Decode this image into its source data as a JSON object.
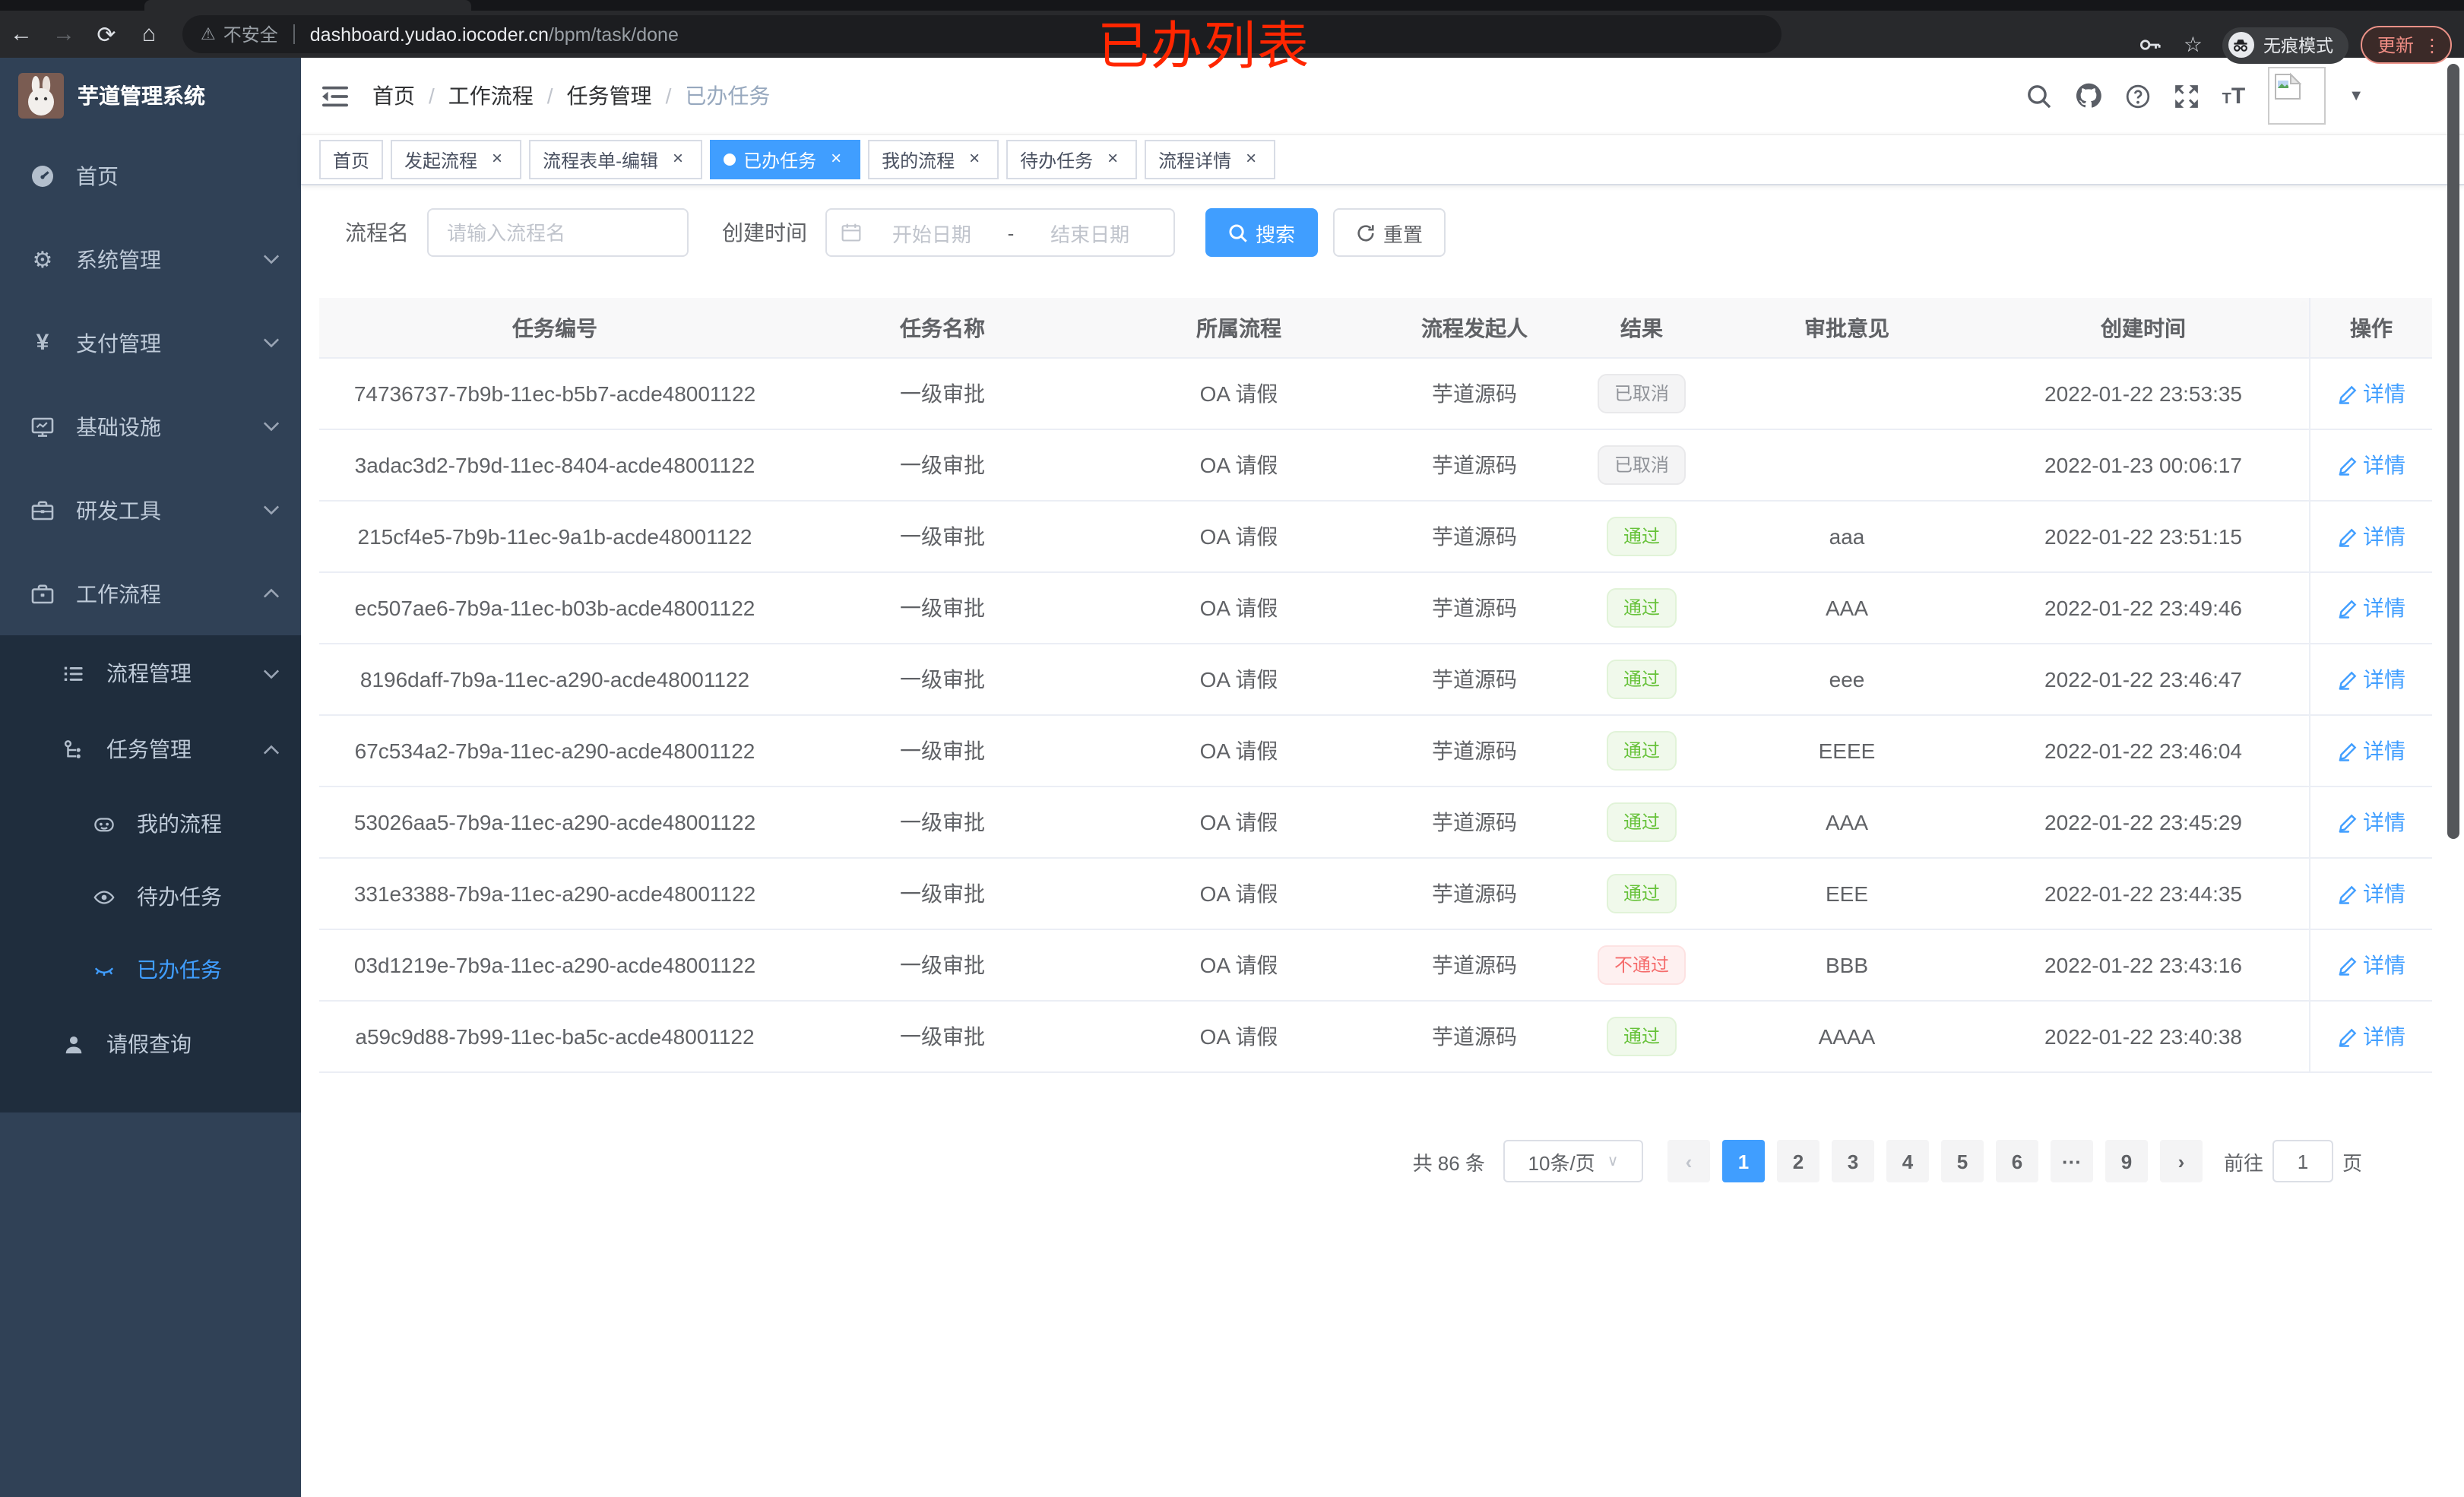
{
  "colors": {
    "accent": "#409eff",
    "success": "#67c23a",
    "danger": "#f56c6c",
    "info": "#909399",
    "sidebar_bg": "#304156",
    "submenu_bg": "#1f2d3d",
    "annotation_red": "#ff2600"
  },
  "browser": {
    "back_icon": "←",
    "forward_icon": "→",
    "reload_icon": "⟳",
    "home_icon": "⌂",
    "warning_icon": "⚠",
    "security_label": "不安全",
    "url_host": "dashboard.yudao.iocoder.cn",
    "url_path": "/bpm/task/done",
    "star_icon": "☆",
    "incognito_label": "无痕模式",
    "update_label": "更新",
    "menu_icon": "⋮"
  },
  "annotation": {
    "text": "已办列表"
  },
  "sidebar": {
    "title": "芋道管理系统",
    "items": [
      {
        "label": "首页",
        "icon": "dashboard-icon"
      },
      {
        "label": "系统管理",
        "icon": "gear-icon"
      },
      {
        "label": "支付管理",
        "icon": "yen-icon",
        "yen": "¥"
      },
      {
        "label": "基础设施",
        "icon": "monitor-icon"
      },
      {
        "label": "研发工具",
        "icon": "toolbox-icon"
      },
      {
        "label": "工作流程",
        "icon": "briefcase-icon"
      },
      {
        "label": "流程管理",
        "icon": "list-icon"
      },
      {
        "label": "任务管理",
        "icon": "flow-icon"
      },
      {
        "label": "我的流程",
        "icon": "robot-icon"
      },
      {
        "label": "待办任务",
        "icon": "eye-open-icon"
      },
      {
        "label": "已办任务",
        "icon": "eye-closed-icon"
      },
      {
        "label": "请假查询",
        "icon": "user-icon"
      }
    ]
  },
  "navbar": {
    "breadcrumb": [
      "首页",
      "工作流程",
      "任务管理",
      "已办任务"
    ],
    "separator": "/",
    "font_size_small": "T",
    "font_size_large": "T",
    "caret_icon": "▼"
  },
  "tags": {
    "close_icon": "×",
    "items": [
      {
        "label": "首页"
      },
      {
        "label": "发起流程"
      },
      {
        "label": "流程表单-编辑"
      },
      {
        "label": "已办任务"
      },
      {
        "label": "我的流程"
      },
      {
        "label": "待办任务"
      },
      {
        "label": "流程详情"
      }
    ]
  },
  "filters": {
    "name_label": "流程名",
    "name_placeholder": "请输入流程名",
    "time_label": "创建时间",
    "start_placeholder": "开始日期",
    "range_separator": "-",
    "end_placeholder": "结束日期",
    "search_label": "搜索",
    "reset_label": "重置"
  },
  "table": {
    "columns": [
      "任务编号",
      "任务名称",
      "所属流程",
      "流程发起人",
      "结果",
      "审批意见",
      "创建时间",
      "操作"
    ],
    "action_label": "详情",
    "rows": [
      {
        "id": "74736737-7b9b-11ec-b5b7-acde48001122",
        "name": "一级审批",
        "process": "OA 请假",
        "starter": "芋道源码",
        "result": "已取消",
        "comment": "",
        "time": "2022-01-22 23:53:35"
      },
      {
        "id": "3adac3d2-7b9d-11ec-8404-acde48001122",
        "name": "一级审批",
        "process": "OA 请假",
        "starter": "芋道源码",
        "result": "已取消",
        "comment": "",
        "time": "2022-01-23 00:06:17"
      },
      {
        "id": "215cf4e5-7b9b-11ec-9a1b-acde48001122",
        "name": "一级审批",
        "process": "OA 请假",
        "starter": "芋道源码",
        "result": "通过",
        "comment": "aaa",
        "time": "2022-01-22 23:51:15"
      },
      {
        "id": "ec507ae6-7b9a-11ec-b03b-acde48001122",
        "name": "一级审批",
        "process": "OA 请假",
        "starter": "芋道源码",
        "result": "通过",
        "comment": "AAA",
        "time": "2022-01-22 23:49:46"
      },
      {
        "id": "8196daff-7b9a-11ec-a290-acde48001122",
        "name": "一级审批",
        "process": "OA 请假",
        "starter": "芋道源码",
        "result": "通过",
        "comment": "eee",
        "time": "2022-01-22 23:46:47"
      },
      {
        "id": "67c534a2-7b9a-11ec-a290-acde48001122",
        "name": "一级审批",
        "process": "OA 请假",
        "starter": "芋道源码",
        "result": "通过",
        "comment": "EEEE",
        "time": "2022-01-22 23:46:04"
      },
      {
        "id": "53026aa5-7b9a-11ec-a290-acde48001122",
        "name": "一级审批",
        "process": "OA 请假",
        "starter": "芋道源码",
        "result": "通过",
        "comment": "AAA",
        "time": "2022-01-22 23:45:29"
      },
      {
        "id": "331e3388-7b9a-11ec-a290-acde48001122",
        "name": "一级审批",
        "process": "OA 请假",
        "starter": "芋道源码",
        "result": "通过",
        "comment": "EEE",
        "time": "2022-01-22 23:44:35"
      },
      {
        "id": "03d1219e-7b9a-11ec-a290-acde48001122",
        "name": "一级审批",
        "process": "OA 请假",
        "starter": "芋道源码",
        "result": "不通过",
        "comment": "BBB",
        "time": "2022-01-22 23:43:16"
      },
      {
        "id": "a59c9d88-7b99-11ec-ba5c-acde48001122",
        "name": "一级审批",
        "process": "OA 请假",
        "starter": "芋道源码",
        "result": "通过",
        "comment": "AAAA",
        "time": "2022-01-22 23:40:38"
      }
    ]
  },
  "pagination": {
    "total": "共 86 条",
    "page_size": "10条/页",
    "prev_icon": "‹",
    "next_icon": "›",
    "pages": [
      "1",
      "2",
      "3",
      "4",
      "5",
      "6",
      "···",
      "9"
    ],
    "active_page": "1",
    "goto_label": "前往",
    "goto_value": "1",
    "unit_label": "页"
  }
}
